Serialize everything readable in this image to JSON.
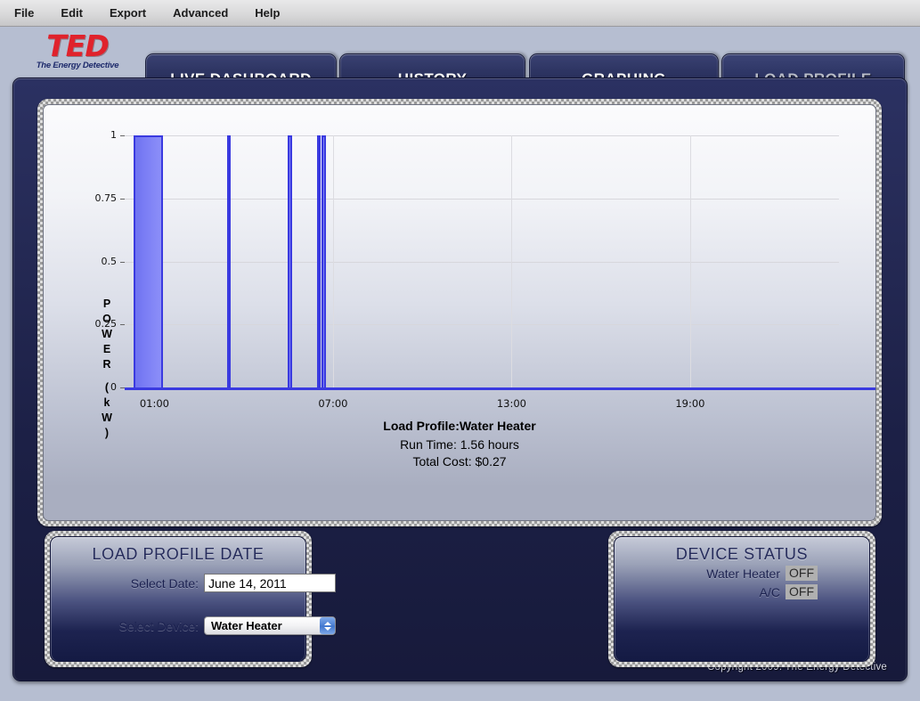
{
  "menubar": {
    "items": [
      "File",
      "Edit",
      "Export",
      "Advanced",
      "Help"
    ]
  },
  "logo": {
    "mark": "TED",
    "tagline": "The Energy Detective"
  },
  "tabs": [
    {
      "label": "LIVE DASHBOARD",
      "active": false
    },
    {
      "label": "HISTORY",
      "active": false
    },
    {
      "label": "GRAPHING",
      "active": false
    },
    {
      "label": "LOAD PROFILE",
      "active": true
    }
  ],
  "chart_data": {
    "type": "bar",
    "title": "Load Profile:Water Heater",
    "xlabel": "",
    "ylabel": "POWER (kW)",
    "ylim": [
      0,
      1
    ],
    "yticks": [
      0,
      0.25,
      0.5,
      0.75,
      1
    ],
    "ytick_labels": [
      "0",
      "0.25",
      "0.5",
      "0.75",
      "1"
    ],
    "xlim": [
      0,
      24
    ],
    "xticks": [
      1,
      7,
      13,
      19
    ],
    "xtick_labels": [
      "01:00",
      "07:00",
      "13:00",
      "19:00"
    ],
    "x_unit": "hour of day",
    "grid": true,
    "legend": "none",
    "bar_color": "#7b7ef5",
    "bar_edge_color": "#3a3ae0",
    "series": [
      {
        "name": "Water Heater",
        "unit": "kW",
        "intervals": [
          {
            "start_hour": 0.3,
            "end_hour": 1.3,
            "value": 1
          },
          {
            "start_hour": 3.45,
            "end_hour": 3.52,
            "value": 1
          },
          {
            "start_hour": 5.48,
            "end_hour": 5.63,
            "value": 1
          },
          {
            "start_hour": 6.47,
            "end_hour": 6.52,
            "value": 1
          },
          {
            "start_hour": 6.62,
            "end_hour": 6.78,
            "value": 1
          }
        ]
      }
    ],
    "annotations": {
      "run_time": "Run Time: 1.56 hours",
      "total_cost": "Total Cost: $0.27"
    }
  },
  "load_profile_date_panel": {
    "title": "LOAD PROFILE DATE",
    "date_label": "Select Date:",
    "date_value": "June 14, 2011",
    "device_label": "Select Device:",
    "device_value": "Water Heater"
  },
  "device_status_panel": {
    "title": "DEVICE STATUS",
    "rows": [
      {
        "name": "Water Heater",
        "state": "OFF"
      },
      {
        "name": "A/C",
        "state": "OFF"
      }
    ]
  },
  "footer": {
    "copyright": "Copyright 2009. The Energy Detective"
  },
  "colors": {
    "brand_red": "#e0222c",
    "navy": "#262c55",
    "plot_blue": "#3a3ae0",
    "window_bg": "#b6bed1"
  }
}
